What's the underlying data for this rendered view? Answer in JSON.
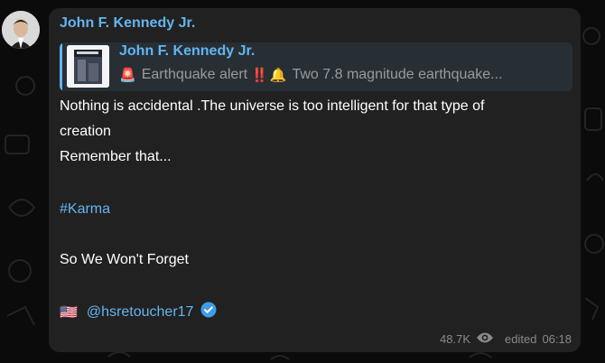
{
  "message": {
    "sender": "John F. Kennedy Jr.",
    "reply": {
      "author": "John F. Kennedy Jr.",
      "emoji_siren": "🚨",
      "text_alert": "Earthquake alert",
      "emoji_exclaim": "‼️",
      "emoji_bell": "🔔",
      "text_preview": "Two 7.8 magnitude earthquake..."
    },
    "line1": "Nothing is accidental .The universe is too intelligent for that type of",
    "line2": "creation",
    "line3": "Remember that...",
    "hashtag": "#Karma",
    "line5": "So We Won't Forget",
    "flag": "🇺🇸",
    "mention": "@hsretoucher17",
    "views": "48.7K",
    "edited_label": "edited",
    "time": "06:18"
  },
  "colors": {
    "accent": "#64b5ef",
    "bubble": "#212121",
    "background": "#0b0b0b",
    "meta_text": "#8a8a8a"
  },
  "icons": {
    "views": "eye-icon",
    "verified": "verified-badge-icon",
    "avatar": "user-avatar"
  }
}
